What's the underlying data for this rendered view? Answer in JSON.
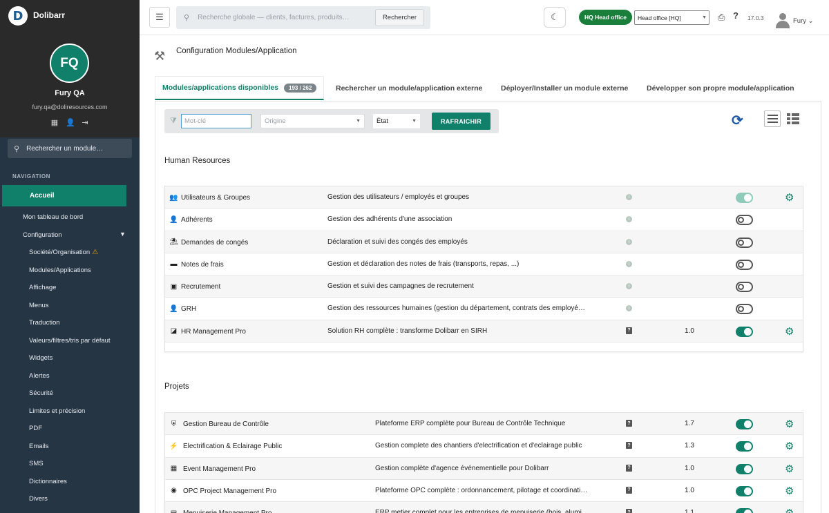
{
  "app": {
    "logo_letter": "D",
    "brand": "Dolibarr"
  },
  "user": {
    "initials": "FQ",
    "name": "Fury QA",
    "email": "fury.qa@doliresources.com",
    "short_name": "Fury"
  },
  "sidebar": {
    "search_placeholder": "Rechercher un module…",
    "nav_title": "NAVIGATION",
    "active_item": "Accueil",
    "items": [
      {
        "label": "Mon tableau de bord",
        "level": 1
      },
      {
        "label": "Configuration",
        "level": 1
      },
      {
        "label": "Société/Organisation",
        "level": 2
      },
      {
        "label": "Modules/Applications",
        "level": 2
      },
      {
        "label": "Affichage",
        "level": 2
      },
      {
        "label": "Menus",
        "level": 2
      },
      {
        "label": "Traduction",
        "level": 2
      },
      {
        "label": "Valeurs/filtres/tris par défaut",
        "level": 2
      },
      {
        "label": "Widgets",
        "level": 2
      },
      {
        "label": "Alertes",
        "level": 2
      },
      {
        "label": "Sécurité",
        "level": 2
      },
      {
        "label": "Limites et précision",
        "level": 2
      },
      {
        "label": "PDF",
        "level": 2
      },
      {
        "label": "Emails",
        "level": 2
      },
      {
        "label": "SMS",
        "level": 2
      },
      {
        "label": "Dictionnaires",
        "level": 2
      },
      {
        "label": "Divers",
        "level": 2
      }
    ]
  },
  "topbar": {
    "search_placeholder": "Recherche globale — clients, factures, produits…",
    "search_button": "Rechercher",
    "entity_badge": "HQ  Head office",
    "entity_select": "Head office [HQ]",
    "version": "17.0.3"
  },
  "page": {
    "title": "Configuration Modules/Application",
    "tabs": [
      {
        "label": "Modules/applications disponibles",
        "count": "193 / 262"
      },
      {
        "label": "Rechercher un module/application externe"
      },
      {
        "label": "Déployer/Installer un module externe"
      },
      {
        "label": "Développer son propre module/application"
      }
    ],
    "filters": {
      "keyword_placeholder": "Mot-clé",
      "origin_placeholder": "Origine",
      "state_value": "État",
      "refresh_button": "RAFRAICHIR"
    }
  },
  "sections": [
    {
      "title": "Human Resources",
      "modules": [
        {
          "icon": "users-icon",
          "name": "Utilisateurs & Groupes",
          "desc": "Gestion des utilisateurs / employés et groupes",
          "badge": "info",
          "version": "",
          "state": "on-light",
          "gear": true
        },
        {
          "icon": "user-icon",
          "name": "Adhérents",
          "desc": "Gestion des adhérents d'une association",
          "badge": "info",
          "version": "",
          "state": "off",
          "gear": false
        },
        {
          "icon": "beach-icon",
          "name": "Demandes de congés",
          "desc": "Déclaration et suivi des congés des employés",
          "badge": "info",
          "version": "",
          "state": "off",
          "gear": false
        },
        {
          "icon": "wallet-icon",
          "name": "Notes de frais",
          "desc": "Gestion et déclaration des notes de frais (transports, repas, ...)",
          "badge": "info",
          "version": "",
          "state": "off",
          "gear": false
        },
        {
          "icon": "badge-icon",
          "name": "Recrutement",
          "desc": "Gestion et suivi des campagnes de recrutement",
          "badge": "info",
          "version": "",
          "state": "off",
          "gear": false
        },
        {
          "icon": "user-tie-icon",
          "name": "GRH",
          "desc": "Gestion des ressources humaines (gestion du département, contrats des employé…",
          "badge": "info",
          "version": "",
          "state": "off",
          "gear": false
        },
        {
          "icon": "hr-pro-icon",
          "name": "HR Management Pro",
          "desc": "Solution RH complète : transforme Dolibarr en SIRH",
          "badge": "help",
          "version": "1.0",
          "state": "on",
          "gear": true
        }
      ]
    },
    {
      "title": "Projets",
      "modules": [
        {
          "icon": "shield-icon",
          "name": "Gestion Bureau de Contrôle",
          "desc": "Plateforme ERP complète pour Bureau de Contrôle Technique",
          "badge": "help",
          "version": "1.7",
          "state": "on",
          "gear": true
        },
        {
          "icon": "lightning-icon",
          "name": "Electrification & Eclairage Public",
          "desc": "Gestion complete des chantiers d'electrification et d'eclairage public",
          "badge": "help",
          "version": "1.3",
          "state": "on",
          "gear": true
        },
        {
          "icon": "calendar-icon",
          "name": "Event Management Pro",
          "desc": "Gestion complète d'agence événementielle pour Dolibarr",
          "badge": "help",
          "version": "1.0",
          "state": "on",
          "gear": true
        },
        {
          "icon": "opc-icon",
          "name": "OPC Project Management Pro",
          "desc": "Plateforme OPC complète : ordonnancement, pilotage et coordinati…",
          "badge": "help",
          "version": "1.0",
          "state": "on",
          "gear": true
        },
        {
          "icon": "wood-icon",
          "name": "Menuiserie Management Pro",
          "desc": "ERP metier complet pour les entreprises de menuiserie (bois, alumi…",
          "badge": "help",
          "version": "1.1",
          "state": "on",
          "gear": true
        }
      ]
    }
  ],
  "colors": {
    "accent": "#10806a",
    "sidebar_bg": "#263544",
    "sidebar_header_bg": "#2a2a2a",
    "sync_blue": "#1f5aa6"
  }
}
